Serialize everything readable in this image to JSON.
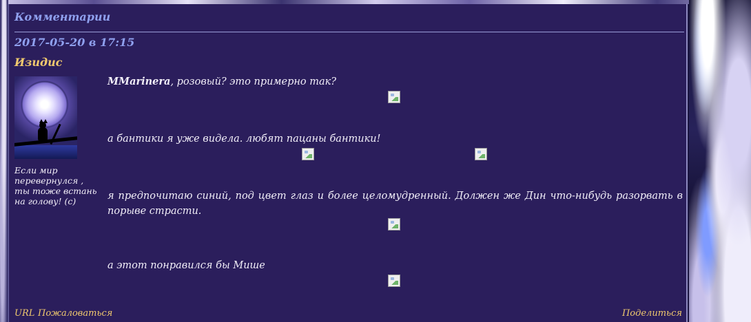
{
  "comments": {
    "section_title": "Комментарии",
    "date": "2017-05-20 в 17:15",
    "author": "Изидис",
    "motto": "Если мир перевернулся , ты тоже встань на голову! (с)",
    "mention": "MMarinera",
    "line1_rest": ", розовый? это примерно так?",
    "line2": "а бантики я уже видела. любят пацаны бантики!",
    "line3": "я предпочитаю синий, под цвет глаз и более целомудренный. Должен же Дин что-нибудь разорвать в порыве страсти.",
    "line4": "а этот понравился бы Мише",
    "footer": {
      "url": "URL",
      "complain": "Пожаловаться",
      "share": "Поделиться"
    },
    "broken_image_icon": "broken-image-icon",
    "colors": {
      "panel": "#2b1e5c",
      "heading": "#8fa0ee",
      "author": "#f0c96e",
      "text": "#f1eef8"
    }
  }
}
